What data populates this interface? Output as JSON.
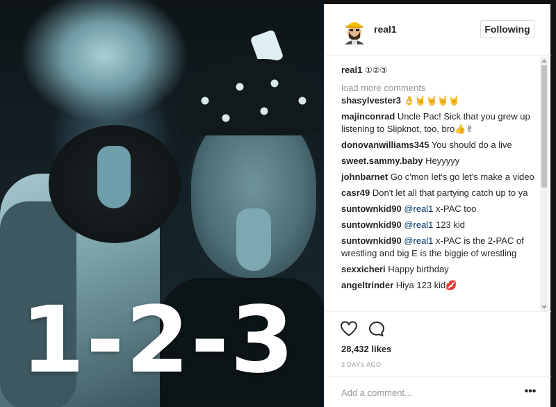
{
  "post": {
    "overlay_text": "1-2-3"
  },
  "header": {
    "username": "real1",
    "follow_label": "Following"
  },
  "caption": {
    "username": "real1",
    "text": "①②③"
  },
  "load_more": "load more comments",
  "comments": [
    {
      "username": "shasylvester3",
      "mention": "",
      "text": "👌🤘🤘🤘🤘"
    },
    {
      "username": "majinconrad",
      "mention": "",
      "text": "Uncle Pac! Sick that you grew up listening to Slipknot, too, bro👍✌"
    },
    {
      "username": "donovanwilliams345",
      "mention": "",
      "text": "You should do a live"
    },
    {
      "username": "sweet.sammy.baby",
      "mention": "",
      "text": "Heyyyyy"
    },
    {
      "username": "johnbarnet",
      "mention": "",
      "text": "Go c'mon let's go let's make a video"
    },
    {
      "username": "casr49",
      "mention": "",
      "text": "Don't let all that partying catch up to ya"
    },
    {
      "username": "suntownkid90",
      "mention": "@real1",
      "text": "x-PAC too"
    },
    {
      "username": "suntownkid90",
      "mention": "@real1",
      "text": "123 kid"
    },
    {
      "username": "suntownkid90",
      "mention": "@real1",
      "text": "x-PAC is the 2-PAC of wrestling and big E is the biggie of wrestling"
    },
    {
      "username": "sexxicheri",
      "mention": "",
      "text": "Happy birthday"
    },
    {
      "username": "angeltrinder",
      "mention": "",
      "text": "Hiya 123 kid💋"
    }
  ],
  "actions": {
    "like_icon": "heart-icon",
    "comment_icon": "speech-bubble-icon",
    "likes": "28,432 likes",
    "timestamp": "3 DAYS AGO"
  },
  "add_comment": {
    "placeholder": "Add a comment...",
    "more_label": "•••"
  },
  "colors": {
    "text": "#262626",
    "muted": "#999999",
    "mention": "#003569",
    "border": "#efefef"
  }
}
